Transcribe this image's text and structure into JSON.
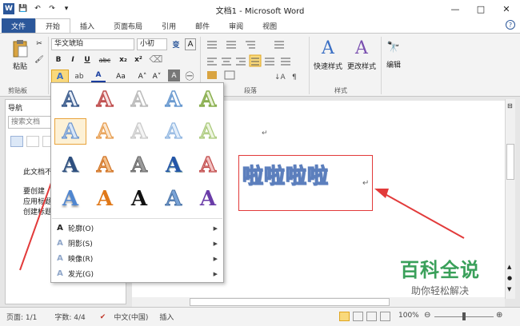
{
  "window": {
    "title": "文档1 - Microsoft Word",
    "logo": "W",
    "minimize": "—",
    "restore": "□",
    "close": "✕",
    "help": "?"
  },
  "quick_access": {
    "save": "💾",
    "undo": "↶",
    "redo": "↷",
    "more": "▾"
  },
  "tabs": [
    {
      "label": "文件"
    },
    {
      "label": "开始"
    },
    {
      "label": "插入"
    },
    {
      "label": "页面布局"
    },
    {
      "label": "引用"
    },
    {
      "label": "邮件"
    },
    {
      "label": "审阅"
    },
    {
      "label": "视图"
    }
  ],
  "ribbon": {
    "clipboard": {
      "paste_label": "粘贴",
      "group_label": "剪贴板"
    },
    "font": {
      "font_name": "华文琥珀",
      "font_size": "小初",
      "wen": "变",
      "a_glyph": "A",
      "buttons": [
        "B",
        "I",
        "U",
        "abc",
        "x₂",
        "x²"
      ],
      "row2": [
        "A",
        "A",
        "Aa",
        "A˄",
        "A˅",
        "A",
        "㊀"
      ]
    },
    "paragraph": {
      "group_label": "段落"
    },
    "styles": {
      "quick_label": "快速样式",
      "change_label": "更改样式",
      "group_label": "样式"
    },
    "editing": {
      "edit_label": "编辑"
    }
  },
  "gallery": {
    "glyph": "A",
    "menu": [
      {
        "label": "轮廓(O)",
        "icon": "outline-icon"
      },
      {
        "label": "阴影(S)",
        "icon": "shadow-icon"
      },
      {
        "label": "映像(R)",
        "icon": "reflection-icon"
      },
      {
        "label": "发光(G)",
        "icon": "glow-icon"
      }
    ]
  },
  "nav_pane": {
    "title": "导航",
    "search_placeholder": "搜索文档",
    "text1": "此文档不",
    "text2": "要创建",
    "text3": "应用标题",
    "text4": "创建标题"
  },
  "document": {
    "para_mark": "↵",
    "wordart_text": "啦啦啦啦",
    "colors": {
      "accent": "#2b579a",
      "annotation": "#e23a3a"
    }
  },
  "watermark": {
    "big": "百科全说",
    "small": "助你轻松解决"
  },
  "statusbar": {
    "page": "页面: 1/1",
    "words": "字数: 4/4",
    "lang": "中文(中国)",
    "mode": "插入",
    "zoom": "100%"
  }
}
